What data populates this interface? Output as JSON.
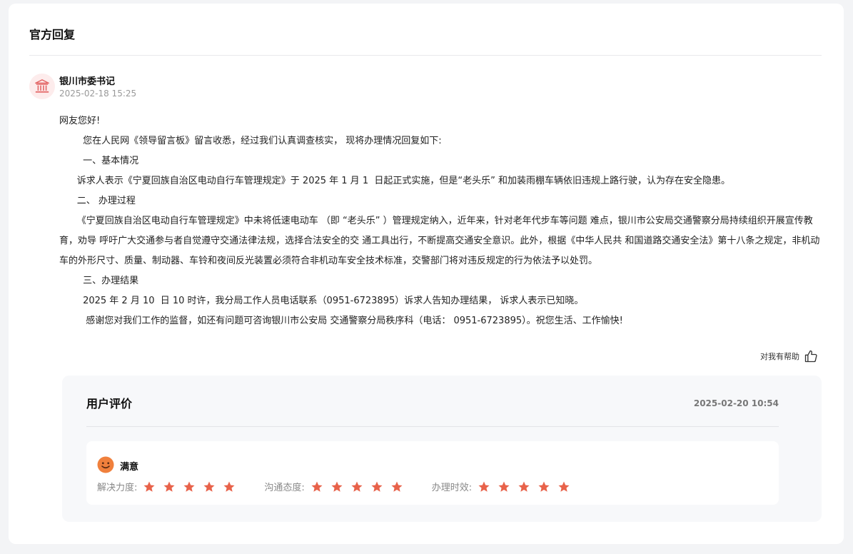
{
  "section_title": "官方回复",
  "responder": {
    "name": "银川市委书记",
    "time": "2025-02-18 15:25",
    "icon": "government-building-icon"
  },
  "reply_paragraphs": [
    "网友您好!",
    "        您在人民网《领导留言板》留言收悉，经过我们认真调查核实， 现将办理情况回复如下:",
    "        一、基本情况",
    "      诉求人表示《宁夏回族自治区电动自行车管理规定》于 2025 年 1 月 1  日起正式实施，但是“老头乐” 和加装雨棚车辆依旧违规上路行驶，认为存在安全隐患。",
    "      二、 办理过程",
    "      《宁夏回族自治区电动自行车管理规定》中未将低速电动车 （即 “老头乐” ）管理规定纳入，近年来，针对老年代步车等问题 难点，银川市公安局交通警察分局持续组织开展宣传教育，劝导 呼吁广大交通参与者自觉遵守交通法律法规，选择合法安全的交 通工具出行，不断提高交通安全意识。此外，根据《中华人民共 和国道路交通安全法》第十八条之规定，非机动车的外形尺寸、质量、制动器、车铃和夜间反光装置必须符合非机动车安全技术标准，交警部门将对违反规定的行为依法予以处罚。",
    "        三、办理结果",
    "        2025 年 2 月 10  日 10 时许，我分局工作人员电话联系（0951-6723895）诉求人告知办理结果， 诉求人表示已知晓。",
    "         感谢您对我们工作的监督，如还有问题可咨询银川市公安局 交通警察分局秩序科（电话： 0951-6723895）。祝您生活、工作愉快!"
  ],
  "helpful": {
    "label": "对我有帮助",
    "icon": "thumbs-up-icon"
  },
  "evaluation": {
    "title": "用户评价",
    "time": "2025-02-20 10:54",
    "satisfaction": "满意",
    "face_icon": "smiley-face-icon",
    "ratings": [
      {
        "label": "解决力度:",
        "stars": 5
      },
      {
        "label": "沟通态度:",
        "stars": 5
      },
      {
        "label": "办理时效:",
        "stars": 5
      }
    ],
    "star_color": "#e8624a"
  },
  "colors": {
    "accent": "#e8624a",
    "avatar_bg": "#fdecec",
    "icon_red": "#e46a6a"
  }
}
